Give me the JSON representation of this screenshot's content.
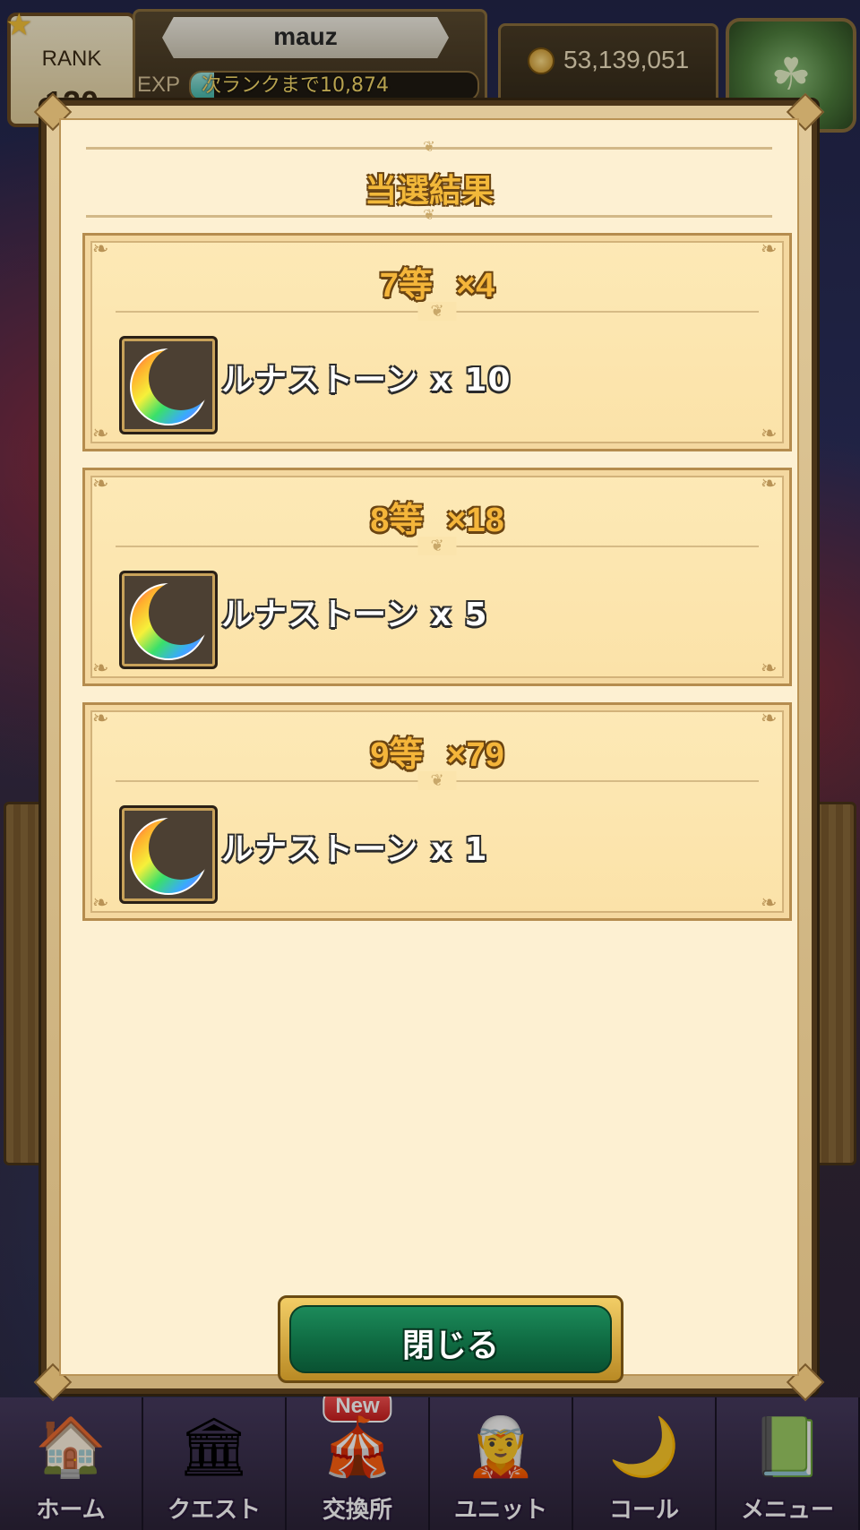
{
  "header": {
    "player_name": "mauz",
    "rank_label": "RANK",
    "rank_value": "120",
    "exp_label": "EXP",
    "exp_text": "次ランクまで10,874",
    "exp_progress": 0.08,
    "coins": "53,139,051"
  },
  "modal": {
    "title": "当選結果",
    "prizes": [
      {
        "tier": "7等",
        "count": "×4",
        "item_name": "ルナストーン x 10",
        "item_icon": "luna-stone-icon"
      },
      {
        "tier": "8等",
        "count": "×18",
        "item_name": "ルナストーン x 5",
        "item_icon": "luna-stone-icon"
      },
      {
        "tier": "9等",
        "count": "×79",
        "item_name": "ルナストーン x 1",
        "item_icon": "luna-stone-icon"
      }
    ],
    "close_label": "閉じる"
  },
  "nav": {
    "items": [
      {
        "label": "ホーム",
        "icon": "home-icon"
      },
      {
        "label": "クエスト",
        "icon": "quest-icon"
      },
      {
        "label": "交換所",
        "icon": "exchange-icon",
        "badge": "New"
      },
      {
        "label": "ユニット",
        "icon": "unit-icon"
      },
      {
        "label": "コール",
        "icon": "call-icon"
      },
      {
        "label": "メニュー",
        "icon": "menu-icon"
      }
    ]
  }
}
